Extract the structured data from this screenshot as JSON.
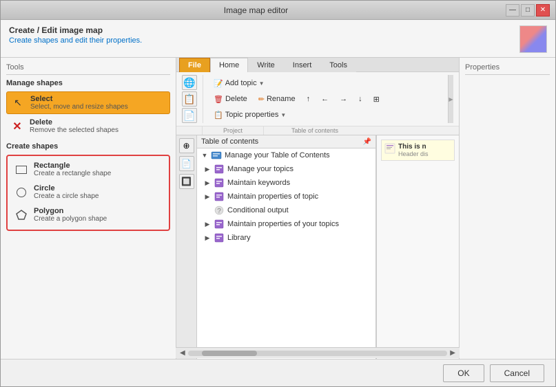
{
  "window": {
    "title": "Image map editor",
    "min_btn": "—",
    "max_btn": "□",
    "close_btn": "✕"
  },
  "header": {
    "title": "Create / Edit image map",
    "subtitle": "Create shapes and edit their properties."
  },
  "tools_panel": {
    "title": "Tools",
    "manage_shapes": {
      "title": "Manage shapes",
      "select": {
        "name": "Select",
        "desc": "Select, move and resize shapes"
      },
      "delete": {
        "name": "Delete",
        "desc": "Remove the selected shapes"
      }
    },
    "create_shapes": {
      "title": "Create shapes",
      "rectangle": {
        "name": "Rectangle",
        "desc": "Create a rectangle shape"
      },
      "circle": {
        "name": "Circle",
        "desc": "Create a circle shape"
      },
      "polygon": {
        "name": "Polygon",
        "desc": "Create a polygon shape"
      }
    }
  },
  "properties_panel": {
    "title": "Properties"
  },
  "ribbon": {
    "tabs": [
      "File",
      "Home",
      "Write",
      "Insert",
      "Tools"
    ],
    "active_tab": "Home",
    "groups": {
      "project_label": "Project",
      "toc_label": "Table of contents"
    },
    "buttons": {
      "add_topic": "Add topic",
      "delete": "Delete",
      "rename": "Rename",
      "topic_properties": "Topic properties"
    }
  },
  "tree": {
    "header": "Table of contents",
    "items": [
      {
        "label": "Manage your Table of Contents",
        "level": 0,
        "has_children": true
      },
      {
        "label": "Manage your topics",
        "level": 1,
        "has_children": true
      },
      {
        "label": "Maintain keywords",
        "level": 1,
        "has_children": true
      },
      {
        "label": "Maintain properties of topic",
        "level": 1,
        "has_children": true
      },
      {
        "label": "Conditional output",
        "level": 1,
        "has_children": false
      },
      {
        "label": "Maintain properties of your topics",
        "level": 1,
        "has_children": true
      },
      {
        "label": "Library",
        "level": 1,
        "has_children": true
      }
    ]
  },
  "preview": {
    "text": "This is n",
    "subtext": "Header dis"
  },
  "bottom": {
    "ok_label": "OK",
    "cancel_label": "Cancel"
  }
}
